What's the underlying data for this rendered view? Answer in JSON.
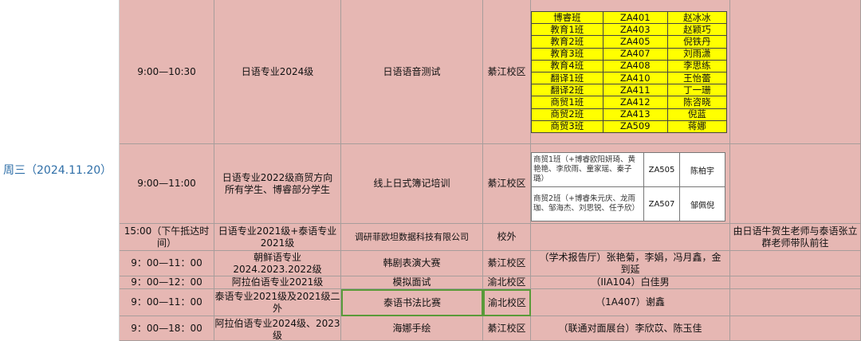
{
  "day": "周三（2024.11.20）",
  "rows": [
    {
      "time": "9:00—10:30",
      "participants": "日语专业2024级",
      "activity": "日语语音测试",
      "location": "綦江校区"
    },
    {
      "time": "9:00—11:00",
      "participants": "日语专业2022级商贸方向所有学生、博睿部分学生",
      "activity": "线上日式簿记培训",
      "location": "綦江校区"
    },
    {
      "time": "15:00（下午抵达时间）",
      "participants": "日语专业2021级+泰语专业2021级",
      "activity": "调研菲欧坦数据科技有限公司",
      "location": "校外",
      "detail": "",
      "note": "由日语牛贺生老师与泰语张立群老师带队前往"
    },
    {
      "time": "9：00—11：00",
      "participants": "朝鲜语专业2024.2023.2022级",
      "activity": "韩剧表演大赛",
      "location": "綦江校区",
      "detail": "（学术报告厅）张艳菊，李娟，冯月鑫，金到延"
    },
    {
      "time": "9：00—12：00",
      "participants": "阿拉伯语专业2021级",
      "activity": "模拟面试",
      "location": "渝北校区",
      "detail": "（IIA104）白佳男"
    },
    {
      "time": "9：00—11：00",
      "participants": "泰语专业2021级及2021级二外",
      "activity": "泰语书法比赛",
      "location": "渝北校区",
      "detail": "（1A407）谢鑫"
    },
    {
      "time": "9：00—18：00",
      "participants": "阿拉伯语专业2024级、2023级",
      "activity": "海娜手绘",
      "location": "綦江校区",
      "detail": "（联通对面展台）李欣苡、陈玉佳"
    }
  ],
  "exam_rooms": [
    {
      "class": "博睿班",
      "room": "ZA401",
      "teacher": "赵冰冰"
    },
    {
      "class": "教育1班",
      "room": "ZA403",
      "teacher": "赵颖巧"
    },
    {
      "class": "教育2班",
      "room": "ZA405",
      "teacher": "倪铁丹"
    },
    {
      "class": "教育3班",
      "room": "ZA407",
      "teacher": "刘雨潇"
    },
    {
      "class": "教育4班",
      "room": "ZA408",
      "teacher": "李思练"
    },
    {
      "class": "翻译1班",
      "room": "ZA410",
      "teacher": "王怡蕾"
    },
    {
      "class": "翻译2班",
      "room": "ZA411",
      "teacher": "丁一珊"
    },
    {
      "class": "商贸1班",
      "room": "ZA412",
      "teacher": "陈咨晓"
    },
    {
      "class": "商贸2班",
      "room": "ZA413",
      "teacher": "倪蓝"
    },
    {
      "class": "商贸3班",
      "room": "ZA509",
      "teacher": "蒋娜"
    }
  ],
  "training_rooms": [
    {
      "class": "商贸1班（+博睿欧阳妍琦、黄艳艳、李欣雨、童家瑶、秦子璐）",
      "room": "ZA505",
      "teacher": "陈柏宇"
    },
    {
      "class": "商贸2班（+博睿朱元庆、龙雨珈、邹海杰、刘思锐、任予欣）",
      "room": "ZA507",
      "teacher": "邹佩倪"
    }
  ]
}
